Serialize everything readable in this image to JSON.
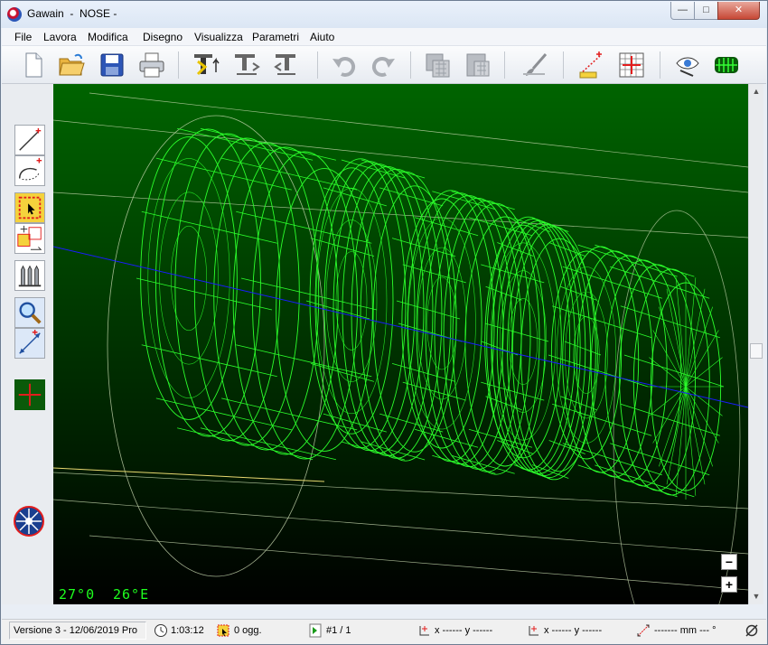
{
  "window": {
    "app_name": "Gawain",
    "separator": "-",
    "document": "NOSE",
    "suffix": "-"
  },
  "menu": [
    "File",
    "Lavora",
    "Modifica",
    "Disegno",
    "Visualizza",
    "Parametri",
    "Aiuto"
  ],
  "toolbar_icons": [
    "new-file-icon",
    "open-folder-icon",
    "save-icon",
    "print-icon",
    "tool-path-icon",
    "tool-transform-icon",
    "tool-reverse-icon",
    "undo-icon",
    "redo-icon",
    "copy-grid-icon",
    "paste-grid-icon",
    "brush-icon",
    "dimension-icon",
    "grid-origin-icon",
    "view-eye-icon",
    "render-3d-icon"
  ],
  "viewport": {
    "background_top": "#006400",
    "background_bottom": "#000000",
    "wire_color": "#2cff2c",
    "axis_color": "#1b1bff",
    "angle_a": "27°0",
    "angle_b": "26°E"
  },
  "status": {
    "version": "Versione 3 - 12/06/2019  Pro",
    "time": "1:03:12",
    "objects": "0 ogg.",
    "page": "#1 / 1",
    "coord1": "x ------    y ------",
    "coord2": "x ------    y ------",
    "measure": "------- mm   ---  °"
  }
}
